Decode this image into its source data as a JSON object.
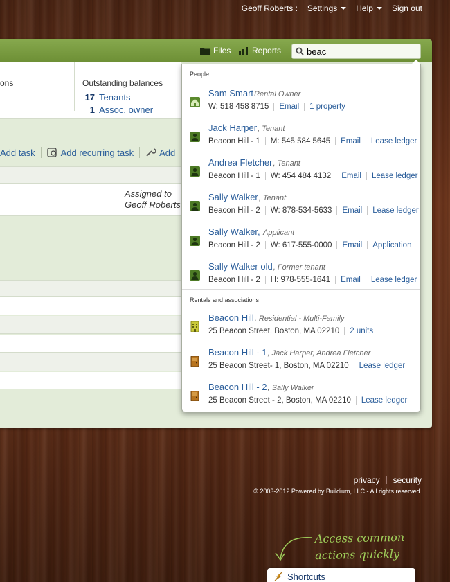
{
  "topnav": {
    "user": "Geoff Roberts :",
    "settings": "Settings",
    "help": "Help",
    "signout": "Sign out"
  },
  "header": {
    "files": "Files",
    "reports": "Reports",
    "search_value": "beac"
  },
  "summary": {
    "col1_label_partial": "ons",
    "col2_label": "Outstanding balances",
    "rows": [
      {
        "count": "17",
        "label": "Tenants"
      },
      {
        "count": "1",
        "label": "Assoc. owner"
      }
    ]
  },
  "toolbar": {
    "add_task": "Add task",
    "add_recurring_task": "Add recurring task",
    "add_partial": "Add"
  },
  "assigned": {
    "line1": "Assigned to",
    "line2": "Geoff Roberts"
  },
  "search_results": {
    "people_title": "People",
    "people": [
      {
        "name": "Sam Smart",
        "role": "Rental Owner",
        "details": [
          "W: 518 458 8715"
        ],
        "links": [
          "Email",
          "1 property"
        ],
        "icon": "home-icon"
      },
      {
        "name": "Jack Harper",
        "role": "Tenant",
        "details": [
          "Beacon Hill - 1",
          "M: 545 584 5645"
        ],
        "links": [
          "Email",
          "Lease ledger"
        ],
        "icon": "person-icon"
      },
      {
        "name": "Andrea Fletcher",
        "role": "Tenant",
        "details": [
          "Beacon Hill - 1",
          "W: 454 484 4132"
        ],
        "links": [
          "Email",
          "Lease ledger"
        ],
        "icon": "person-icon"
      },
      {
        "name": "Sally Walker",
        "role": "Tenant",
        "details": [
          "Beacon Hill - 2",
          "W: 878-534-5633"
        ],
        "links": [
          "Email",
          "Lease ledger"
        ],
        "icon": "person-icon"
      },
      {
        "name": "Sally Walker,",
        "role": "Applicant",
        "details": [
          "Beacon Hill - 2",
          "W: 617-555-0000"
        ],
        "links": [
          "Email",
          "Application"
        ],
        "icon": "person-icon"
      },
      {
        "name": "Sally Walker old",
        "role": "Former tenant",
        "details": [
          "Beacon Hill - 2",
          "H: 978-555-1641"
        ],
        "links": [
          "Email",
          "Lease ledger"
        ],
        "icon": "person-icon"
      }
    ],
    "rentals_title": "Rentals and associations",
    "rentals": [
      {
        "name": "Beacon Hill",
        "role": "Residential - Multi-Family",
        "details": [
          "25 Beacon Street, Boston, MA 02210"
        ],
        "links": [
          "2 units"
        ],
        "icon": "building-icon"
      },
      {
        "name": "Beacon Hill - 1",
        "role": "Jack Harper, Andrea Fletcher",
        "details": [
          "25 Beacon Street- 1, Boston, MA 02210"
        ],
        "links": [
          "Lease ledger"
        ],
        "icon": "door-icon"
      },
      {
        "name": "Beacon Hill - 2",
        "role": "Sally Walker",
        "details": [
          "25 Beacon Street - 2, Boston, MA 02210"
        ],
        "links": [
          "Lease ledger"
        ],
        "icon": "door-icon"
      }
    ]
  },
  "footer": {
    "privacy": "privacy",
    "security": "security",
    "copyright": "© 2003-2012 Powered by Buildium, LLC - All rights reserved."
  },
  "hint": {
    "line1": "Access common",
    "line2": "actions quickly"
  },
  "shortcuts": {
    "label": "Shortcuts"
  }
}
